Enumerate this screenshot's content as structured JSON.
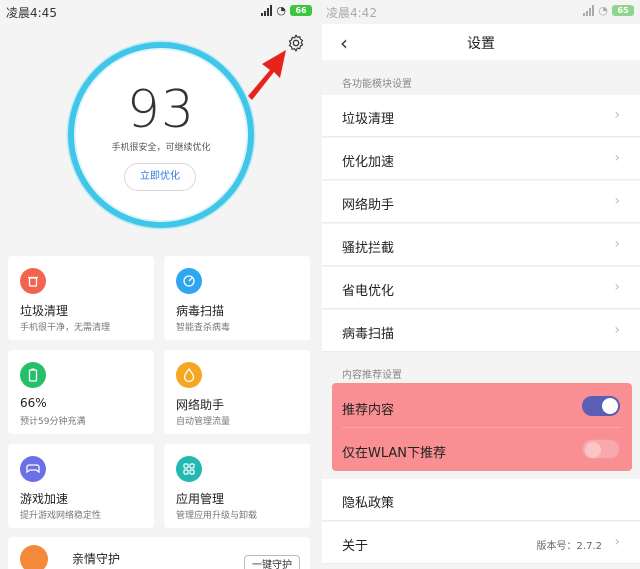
{
  "left": {
    "status": {
      "time": "凌晨4:45",
      "battery": "66"
    },
    "score": {
      "value": "93",
      "subtitle": "手机很安全，可继续优化",
      "button": "立即优化"
    },
    "cards": [
      {
        "title": "垃圾清理",
        "subtitle": "手机很干净，无需清理",
        "color": "#f2644f",
        "icon": "trash-icon"
      },
      {
        "title": "病毒扫描",
        "subtitle": "智能查杀病毒",
        "color": "#2fa7ee",
        "icon": "scan-icon"
      },
      {
        "title": "66%",
        "subtitle": "预计59分钟充满",
        "color": "#26c06b",
        "icon": "battery-icon"
      },
      {
        "title": "网络助手",
        "subtitle": "自动管理流量",
        "color": "#f4a724",
        "icon": "droplet-icon"
      },
      {
        "title": "游戏加速",
        "subtitle": "提升游戏网络稳定性",
        "color": "#6b6fe8",
        "icon": "gamepad-icon"
      },
      {
        "title": "应用管理",
        "subtitle": "管理应用升级与卸载",
        "color": "#22b9b0",
        "icon": "grid-icon"
      }
    ],
    "family": {
      "title": "亲情守护",
      "button": "一键守护"
    }
  },
  "right": {
    "status": {
      "time": "凌晨4:42",
      "battery": "65"
    },
    "title": "设置",
    "section1_label": "各功能模块设置",
    "module_items": [
      "垃圾清理",
      "优化加速",
      "网络助手",
      "骚扰拦截",
      "省电优化",
      "病毒扫描"
    ],
    "section2_label": "内容推荐设置",
    "recommend": [
      {
        "label": "推荐内容",
        "on": true
      },
      {
        "label": "仅在WLAN下推荐",
        "on": false
      }
    ],
    "privacy": "隐私政策",
    "about": {
      "label": "关于",
      "version": "版本号：2.7.2"
    }
  },
  "colors": {
    "accent": "#2a7de1",
    "highlight": "#f98f92",
    "toggle_on": "#5b5eb5",
    "ring": "#3fc6e8",
    "arrow": "#e8231b"
  }
}
